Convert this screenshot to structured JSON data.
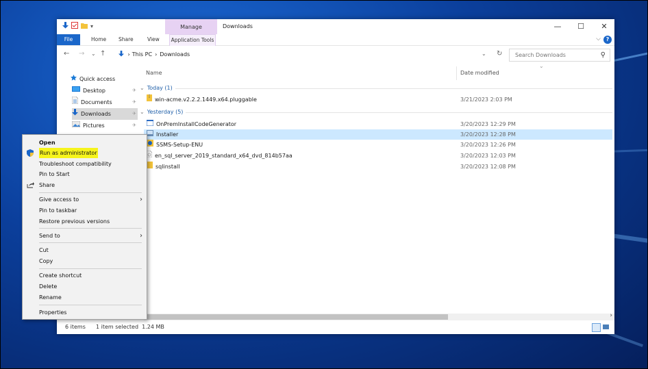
{
  "window": {
    "title": "Downloads",
    "manage_tab": "Manage",
    "controls": {
      "minimize": "—",
      "maximize": "☐",
      "close": "✕"
    },
    "qa_dropdown": "▾"
  },
  "ribbon": {
    "tabs": [
      "File",
      "Home",
      "Share",
      "View",
      "Application Tools"
    ],
    "expand": "⌵",
    "help": "?"
  },
  "address": {
    "back": "←",
    "forward": "→",
    "recent": "⌄",
    "up": "↑",
    "crumbs": [
      "This PC",
      "Downloads"
    ],
    "crumb_sep": "›",
    "dropdown": "⌄",
    "refresh": "↻",
    "search_placeholder": "Search Downloads",
    "search_icon": "⚲"
  },
  "nav": {
    "items": [
      {
        "label": "Quick access",
        "icon": "star"
      },
      {
        "label": "Desktop",
        "icon": "desktop",
        "pinned": true
      },
      {
        "label": "Documents",
        "icon": "documents",
        "pinned": true
      },
      {
        "label": "Downloads",
        "icon": "download-arrow",
        "pinned": true,
        "selected": true
      },
      {
        "label": "Pictures",
        "icon": "pictures",
        "pinned": true
      }
    ],
    "pin_glyph": "✈"
  },
  "columns": {
    "name": "Name",
    "date": "Date modified",
    "sort_glyph": "⌄"
  },
  "groups": [
    {
      "label": "Today (1)",
      "files": [
        {
          "name": "win-acme.v2.2.2.1449.x64.pluggable",
          "date": "3/21/2023 2:03 PM",
          "icon": "zip-folder"
        }
      ]
    },
    {
      "label": "Yesterday (5)",
      "files": [
        {
          "name": "OnPremInstallCodeGenerator",
          "date": "3/20/2023 12:29 PM",
          "icon": "app"
        },
        {
          "name": "Installer",
          "date": "3/20/2023 12:28 PM",
          "icon": "installer",
          "selected": true
        },
        {
          "name": "SSMS-Setup-ENU",
          "date": "3/20/2023 12:26 PM",
          "icon": "setup"
        },
        {
          "name": "en_sql_server_2019_standard_x64_dvd_814b57aa",
          "date": "3/20/2023 12:03 PM",
          "icon": "disc-image"
        },
        {
          "name": "sqlinstall",
          "date": "3/20/2023 12:08 PM",
          "icon": "folder"
        }
      ]
    }
  ],
  "status": {
    "count": "6 items",
    "selection": "1 item selected  1.24 MB"
  },
  "scroll_right": "›",
  "context_menu": [
    {
      "label": "Open",
      "bold": true
    },
    {
      "label": "Run as administrator",
      "icon": "shield",
      "highlight": true
    },
    {
      "label": "Troubleshoot compatibility"
    },
    {
      "label": "Pin to Start"
    },
    {
      "label": "Share",
      "icon": "share"
    },
    {
      "label": "Give access to",
      "submenu": true
    },
    {
      "label": "Pin to taskbar"
    },
    {
      "label": "Restore previous versions"
    },
    {
      "label": "Send to",
      "submenu": true
    },
    {
      "label": "Cut"
    },
    {
      "label": "Copy"
    },
    {
      "label": "Create shortcut"
    },
    {
      "label": "Delete"
    },
    {
      "label": "Rename"
    },
    {
      "label": "Properties"
    }
  ],
  "colors": {
    "accent": "#1a66c9",
    "selection": "#cce8ff",
    "manage": "#e7d2f3",
    "highlight": "#f6f41c"
  }
}
